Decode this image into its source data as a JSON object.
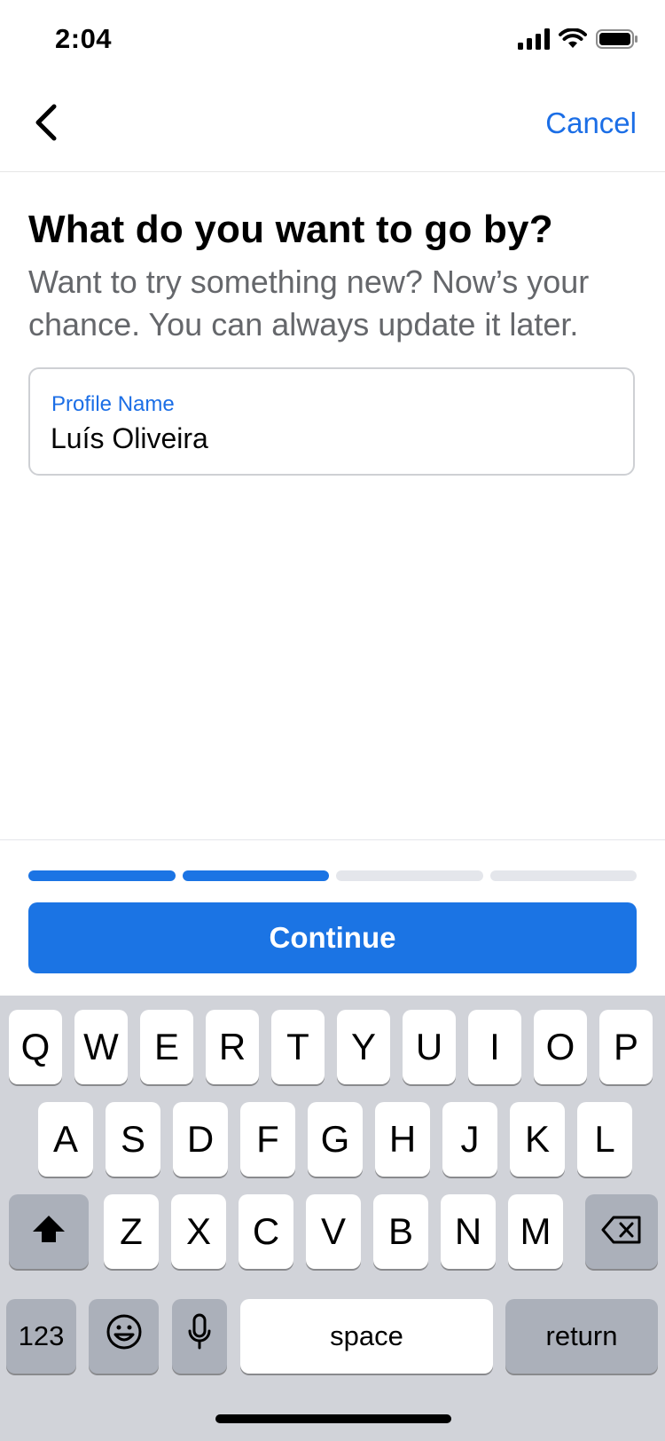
{
  "status_bar": {
    "time": "2:04",
    "icons": [
      "cellular-signal-icon",
      "wifi-icon",
      "battery-icon"
    ]
  },
  "nav": {
    "back_icon": "chevron-left-icon",
    "cancel_label": "Cancel"
  },
  "content": {
    "title": "What do you want to go by?",
    "subtitle": "Want to try something new? Now’s your chance. You can always update it later.",
    "name_field": {
      "label": "Profile Name",
      "value": "Luís Oliveira"
    }
  },
  "progress": {
    "steps_total": 4,
    "steps_completed": 2
  },
  "continue_label": "Continue",
  "keyboard": {
    "row1": [
      "Q",
      "W",
      "E",
      "R",
      "T",
      "Y",
      "U",
      "I",
      "O",
      "P"
    ],
    "row2": [
      "A",
      "S",
      "D",
      "F",
      "G",
      "H",
      "J",
      "K",
      "L"
    ],
    "row3": [
      "Z",
      "X",
      "C",
      "V",
      "B",
      "N",
      "M"
    ],
    "numbers_label": "123",
    "space_label": "space",
    "return_label": "return",
    "shift_icon": "shift-icon",
    "delete_icon": "backspace-icon",
    "emoji_icon": "emoji-icon",
    "mic_icon": "microphone-icon"
  },
  "colors": {
    "accent": "#1b74e4",
    "link": "#1b6ee6",
    "secondary_text": "#65676b",
    "keyboard_bg": "#d1d3d9"
  }
}
